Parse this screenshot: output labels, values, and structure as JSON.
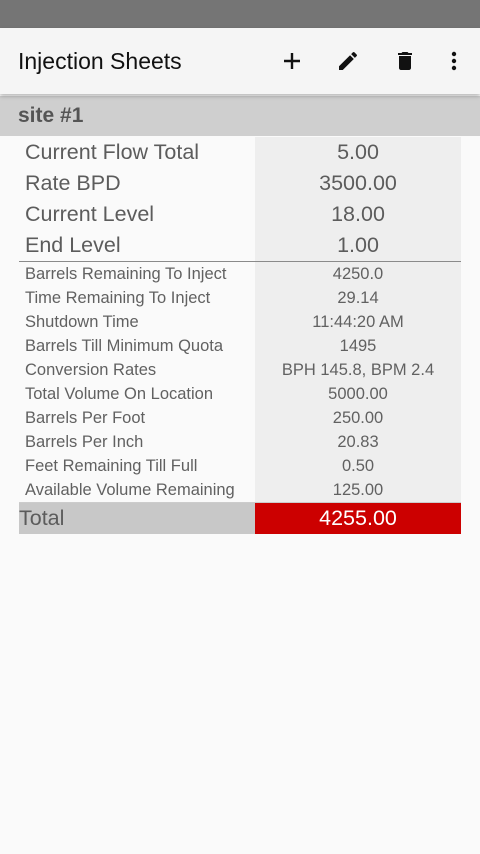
{
  "app_bar": {
    "title": "Injection Sheets",
    "actions": [
      "add-icon",
      "edit-icon",
      "delete-icon",
      "more-vert-icon"
    ]
  },
  "site": {
    "name": "site #1"
  },
  "primary_rows": [
    {
      "label": "Current Flow Total",
      "value": "5.00"
    },
    {
      "label": "Rate BPD",
      "value": "3500.00"
    },
    {
      "label": "Current Level",
      "value": "18.00"
    },
    {
      "label": "End Level",
      "value": "1.00"
    }
  ],
  "detail_rows": [
    {
      "label": "Barrels Remaining To Inject",
      "value": "4250.0"
    },
    {
      "label": "Time Remaining To Inject",
      "value": "29.14"
    },
    {
      "label": "Shutdown Time",
      "value": "11:44:20 AM"
    },
    {
      "label": "Barrels Till Minimum Quota",
      "value": "1495"
    },
    {
      "label": "Conversion Rates",
      "value": "BPH 145.8, BPM 2.4"
    },
    {
      "label": "Total Volume On Location",
      "value": "5000.00"
    },
    {
      "label": "Barrels Per Foot",
      "value": "250.00"
    },
    {
      "label": "Barrels Per Inch",
      "value": "20.83"
    },
    {
      "label": "Feet Remaining Till Full",
      "value": "0.50"
    },
    {
      "label": "Available Volume Remaining",
      "value": "125.00"
    }
  ],
  "total": {
    "label": "Total",
    "value": "4255.00"
  },
  "colors": {
    "total_highlight": "#cc0000",
    "status_bar": "#757575",
    "subheader": "#cfcfcf"
  }
}
